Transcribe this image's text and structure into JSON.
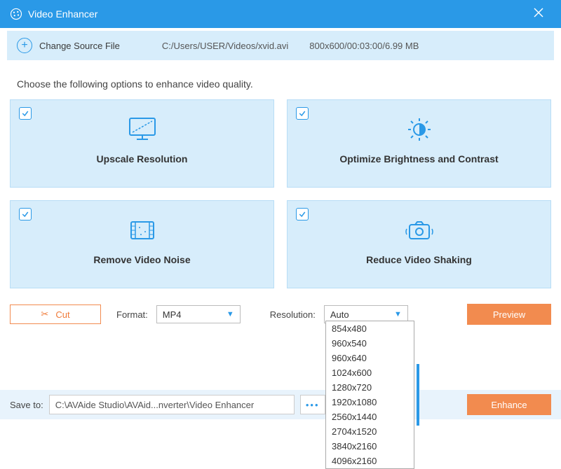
{
  "titlebar": {
    "title": "Video Enhancer"
  },
  "sourcebar": {
    "change_label": "Change Source File",
    "filepath": "C:/Users/USER/Videos/xvid.avi",
    "fileinfo": "800x600/00:03:00/6.99 MB"
  },
  "instruction": "Choose the following options to enhance video quality.",
  "options": {
    "upscale": "Upscale Resolution",
    "brightness": "Optimize Brightness and Contrast",
    "noise": "Remove Video Noise",
    "shaking": "Reduce Video Shaking"
  },
  "controls": {
    "cut": "Cut",
    "format_label": "Format:",
    "format_value": "MP4",
    "resolution_label": "Resolution:",
    "resolution_value": "Auto",
    "preview": "Preview"
  },
  "resolution_options": [
    "854x480",
    "960x540",
    "960x640",
    "1024x600",
    "1280x720",
    "1920x1080",
    "2560x1440",
    "2704x1520",
    "3840x2160",
    "4096x2160"
  ],
  "savebar": {
    "label": "Save to:",
    "path": "C:\\AVAide Studio\\AVAid...nverter\\Video Enhancer",
    "enhance": "Enhance"
  }
}
